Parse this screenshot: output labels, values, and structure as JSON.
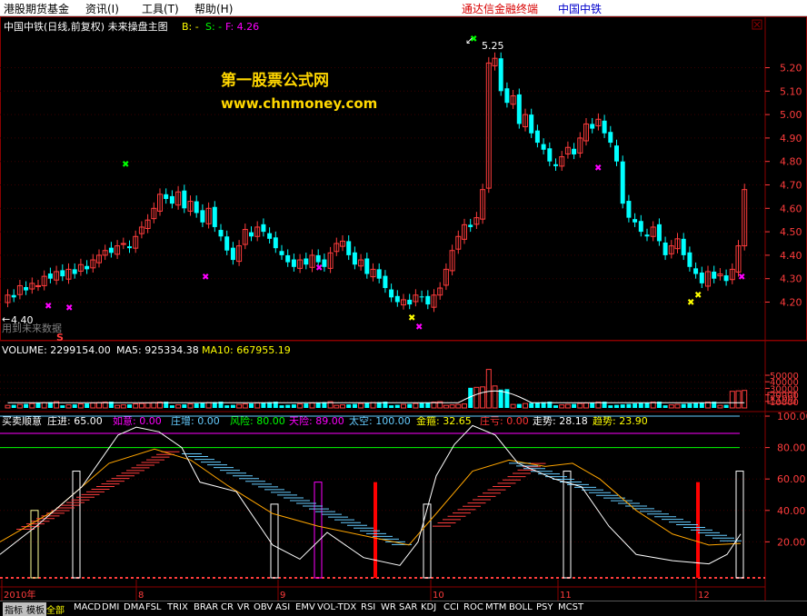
{
  "menu": {
    "items": [
      {
        "label": "港股期货基金",
        "x": 4
      },
      {
        "label": "资讯(I)",
        "x": 94
      },
      {
        "label": "工具(T)",
        "x": 156
      },
      {
        "label": "帮助(H)",
        "x": 214
      }
    ],
    "brand": "通达信金融终端",
    "stock": "中国中铁"
  },
  "main_panel": {
    "title": "中国中铁(日线,前复权) 未来操盘主图",
    "ind_b": "B: -",
    "ind_s": "S: -",
    "ind_f": "F: 4.26",
    "watermark_1": "第一股票公式网",
    "watermark_2": "www.chnmoney.com",
    "future_data_note": "用到未来数据",
    "s_marker": "S",
    "high_label": "5.25",
    "low_label": "4.40",
    "y_ticks": [
      "5.20",
      "5.10",
      "5.00",
      "4.90",
      "4.80",
      "4.70",
      "4.60",
      "4.50",
      "4.40",
      "4.30",
      "4.20"
    ]
  },
  "volume_panel": {
    "volume": "VOLUME: 2299154.00",
    "ma5": "MA5: 925334.38",
    "ma10": "MA10: 667955.19",
    "y_ticks": [
      "50000",
      "40000",
      "30000",
      "20000",
      "10000"
    ],
    "unit": "X100"
  },
  "indicator_panel": {
    "name": "买卖顺意",
    "values": [
      {
        "label": "庄进: 65.00",
        "color": "#ffffff"
      },
      {
        "label": "如意: 0.00",
        "color": "#ff00ff"
      },
      {
        "label": "庄增: 0.00",
        "color": "#66ccff"
      },
      {
        "label": "风险: 80.00",
        "color": "#00ff00"
      },
      {
        "label": "天险: 89.00",
        "color": "#ff00ff"
      },
      {
        "label": "太空: 100.00",
        "color": "#66ccff"
      },
      {
        "label": "金箍: 32.65",
        "color": "#ffff00"
      },
      {
        "label": "庄亏: 0.00",
        "color": "#ff3333"
      },
      {
        "label": "走势: 28.18",
        "color": "#ffffff"
      },
      {
        "label": "趋势: 23.90",
        "color": "#ffff00"
      }
    ],
    "y_ticks": [
      "100.00",
      "80.00",
      "60.00",
      "40.00",
      "20.00"
    ]
  },
  "date_axis": {
    "labels": [
      "2010年",
      "8",
      "9",
      "10",
      "11",
      "12"
    ]
  },
  "tabs": {
    "items": [
      "指标",
      "模板",
      "全部",
      "MACD",
      "DMI",
      "DMA",
      "FSL",
      "TRIX",
      "BRAR",
      "CR",
      "VR",
      "OBV",
      "ASI",
      "EMV",
      "VOL-TDX",
      "RSI",
      "WR",
      "SAR",
      "KDJ",
      "CCI",
      "ROC",
      "MTM",
      "BOLL",
      "PSY",
      "MCST"
    ],
    "active": "全部"
  },
  "colors": {
    "up": "#ff3c3c",
    "down": "#00ffff",
    "grid": "#8b0000",
    "axis_text": "#ff3c3c"
  }
}
